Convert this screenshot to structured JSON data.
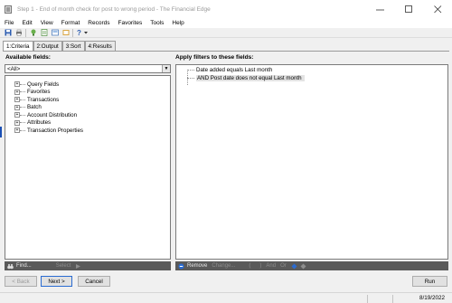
{
  "window": {
    "title": "Step 1 - End of month check for post to wrong period - The Financial Edge",
    "controls": [
      "minimize-icon",
      "maximize-icon",
      "close-icon"
    ]
  },
  "menu": [
    "File",
    "Edit",
    "View",
    "Format",
    "Records",
    "Favorites",
    "Tools",
    "Help"
  ],
  "toolbar": {
    "buttons": [
      "save-icon",
      "print-icon",
      "help-bulb-icon",
      "export-icon",
      "preview-icon",
      "layout-icon",
      "help-icon"
    ]
  },
  "tabs": [
    "1:Criteria",
    "2:Output",
    "3:Sort",
    "4:Results"
  ],
  "active_tab": "1:Criteria",
  "available_fields": {
    "label": "Available fields:",
    "filter_value": "<All>",
    "items": [
      "Query Fields",
      "Favorites",
      "Transactions",
      "Batch",
      "Account Distribution",
      "Attributes",
      "Transaction Properties"
    ]
  },
  "filters": {
    "label": "Apply filters to these fields:",
    "rows": [
      "Date added equals Last month",
      "AND Post date does not equal Last month"
    ]
  },
  "left_footer": {
    "find": "Find...",
    "select": "Select"
  },
  "right_footer": {
    "remove": "Remove",
    "change": "Change...",
    "open_paren": "(",
    "close_paren": ")",
    "and": "And",
    "or": "Or"
  },
  "buttons": {
    "back": "< Back",
    "next": "Next >",
    "cancel": "Cancel",
    "run": "Run"
  },
  "status": {
    "date": "8/19/2022"
  },
  "colors": {
    "footer_bg": "#5a5a5a",
    "accent": "#2a6bd1",
    "selected_row": "#e3e3e3"
  }
}
